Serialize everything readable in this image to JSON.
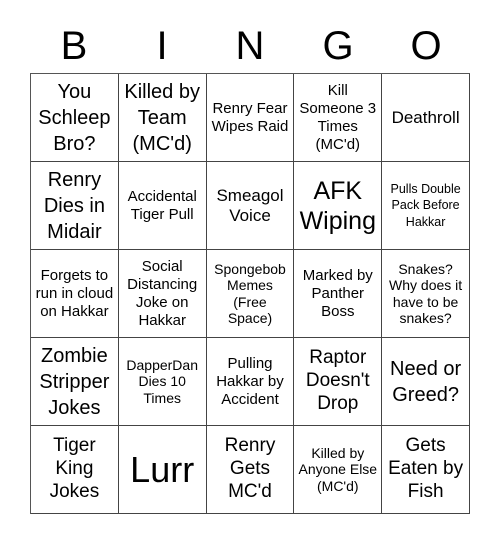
{
  "title_letters": [
    "B",
    "I",
    "N",
    "G",
    "O"
  ],
  "cells": [
    [
      "You Schleep Bro?",
      "Killed by Team (MC'd)",
      "Renry Fear Wipes Raid",
      "Kill Someone 3 Times (MC'd)",
      "Deathroll"
    ],
    [
      "Renry Dies in Midair",
      "Accidental Tiger Pull",
      "Smeagol Voice",
      "AFK Wiping",
      "Pulls Double Pack Before Hakkar"
    ],
    [
      "Forgets to run in cloud on Hakkar",
      "Social Distancing Joke on Hakkar",
      "Spongebob Memes (Free Space)",
      "Marked by Panther Boss",
      "Snakes? Why does it have to be snakes?"
    ],
    [
      "Zombie Stripper Jokes",
      "DapperDan Dies 10 Times",
      "Pulling Hakkar by Accident",
      "Raptor Doesn't Drop",
      "Need or Greed?"
    ],
    [
      "Tiger King Jokes",
      "Lurr",
      "Renry Gets MC'd",
      "Killed by Anyone Else (MC'd)",
      "Gets Eaten by Fish"
    ]
  ]
}
